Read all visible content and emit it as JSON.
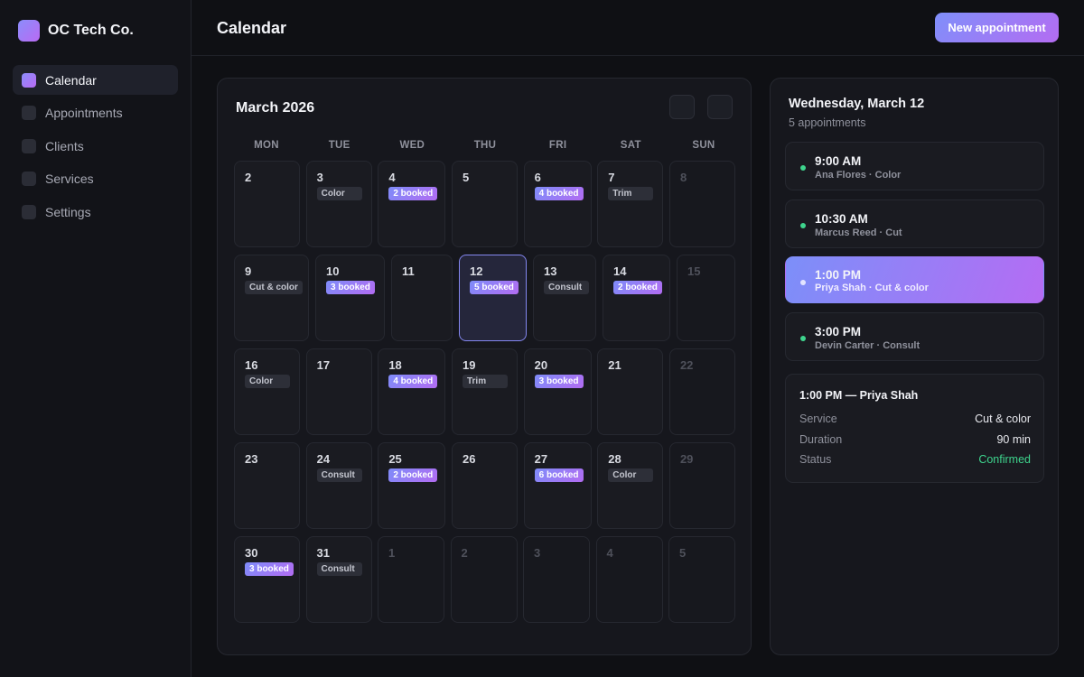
{
  "brand": {
    "name": "OC Tech Co."
  },
  "sidebar": {
    "items": [
      {
        "label": "Calendar",
        "active": true
      },
      {
        "label": "Appointments"
      },
      {
        "label": "Clients"
      },
      {
        "label": "Services"
      },
      {
        "label": "Settings"
      }
    ]
  },
  "header": {
    "title": "Calendar",
    "new_button": "New appointment"
  },
  "calendar": {
    "month_label": "March 2026",
    "weekdays": [
      "MON",
      "TUE",
      "WED",
      "THU",
      "FRI",
      "SAT",
      "SUN"
    ],
    "weeks": [
      [
        {
          "day": "2"
        },
        {
          "day": "3",
          "tag": "Color",
          "tag_type": "service"
        },
        {
          "day": "4",
          "tag": "2 booked",
          "tag_type": "booked"
        },
        {
          "day": "5"
        },
        {
          "day": "6",
          "tag": "4 booked",
          "tag_type": "booked"
        },
        {
          "day": "7",
          "tag": "Trim",
          "tag_type": "service"
        },
        {
          "day": "8",
          "muted": true
        }
      ],
      [
        {
          "day": "9",
          "tag": "Cut & color",
          "tag_type": "service"
        },
        {
          "day": "10",
          "tag": "3 booked",
          "tag_type": "booked"
        },
        {
          "day": "11"
        },
        {
          "day": "12",
          "tag": "5 booked",
          "tag_type": "booked",
          "selected": true
        },
        {
          "day": "13",
          "tag": "Consult",
          "tag_type": "service"
        },
        {
          "day": "14",
          "tag": "2 booked",
          "tag_type": "booked"
        },
        {
          "day": "15",
          "muted": true
        }
      ],
      [
        {
          "day": "16",
          "tag": "Color",
          "tag_type": "service"
        },
        {
          "day": "17"
        },
        {
          "day": "18",
          "tag": "4 booked",
          "tag_type": "booked"
        },
        {
          "day": "19",
          "tag": "Trim",
          "tag_type": "service"
        },
        {
          "day": "20",
          "tag": "3 booked",
          "tag_type": "booked"
        },
        {
          "day": "21"
        },
        {
          "day": "22",
          "muted": true
        }
      ],
      [
        {
          "day": "23"
        },
        {
          "day": "24",
          "tag": "Consult",
          "tag_type": "service"
        },
        {
          "day": "25",
          "tag": "2 booked",
          "tag_type": "booked"
        },
        {
          "day": "26"
        },
        {
          "day": "27",
          "tag": "6 booked",
          "tag_type": "booked"
        },
        {
          "day": "28",
          "tag": "Color",
          "tag_type": "service"
        },
        {
          "day": "29",
          "muted": true
        }
      ],
      [
        {
          "day": "30",
          "tag": "3 booked",
          "tag_type": "booked"
        },
        {
          "day": "31",
          "tag": "Consult",
          "tag_type": "service"
        },
        {
          "day": "1",
          "muted": true
        },
        {
          "day": "2",
          "muted": true
        },
        {
          "day": "3",
          "muted": true
        },
        {
          "day": "4",
          "muted": true
        },
        {
          "day": "5",
          "muted": true
        }
      ]
    ]
  },
  "day_panel": {
    "title": "Wednesday, March 12",
    "subtitle": "5 appointments",
    "appointments": [
      {
        "time": "9:00 AM",
        "meta": "Ana Flores · Color"
      },
      {
        "time": "10:30 AM",
        "meta": "Marcus Reed · Cut"
      },
      {
        "time": "1:00 PM",
        "meta": "Priya Shah · Cut & color",
        "active": true
      },
      {
        "time": "3:00 PM",
        "meta": "Devin Carter · Consult"
      }
    ],
    "detail": {
      "title": "1:00 PM — Priya Shah",
      "rows": [
        {
          "key": "Service",
          "value": "Cut & color"
        },
        {
          "key": "Duration",
          "value": "90 min"
        },
        {
          "key": "Status",
          "value": "Confirmed"
        }
      ]
    }
  },
  "colors": {
    "accent_start": "#7f8ffa",
    "accent_end": "#b46cf2",
    "confirmed": "#3ed48d",
    "background": "#0f1014"
  }
}
